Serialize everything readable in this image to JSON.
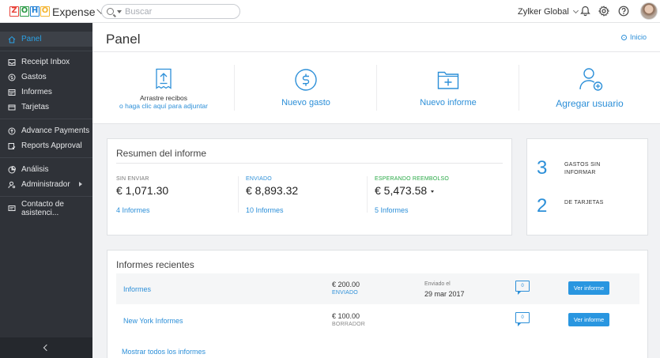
{
  "app": {
    "logo_letters": [
      "Z",
      "O",
      "H",
      "O"
    ],
    "logo_colors": [
      "#e8433a",
      "#2b9a46",
      "#1f7fd4",
      "#f3b431"
    ],
    "product_name": "Expense"
  },
  "topbar": {
    "search_placeholder": "Buscar",
    "org_name": "Zylker Global",
    "icons": [
      "bell-icon",
      "gear-icon",
      "help-icon"
    ]
  },
  "sidebar": {
    "items": [
      {
        "label": "Panel",
        "icon": "home-icon",
        "active": true
      },
      {
        "label": "Receipt Inbox",
        "icon": "inbox-icon"
      },
      {
        "label": "Gastos",
        "icon": "coin-icon"
      },
      {
        "label": "Informes",
        "icon": "report-icon"
      },
      {
        "label": "Tarjetas",
        "icon": "card-icon"
      },
      {
        "label": "Advance Payments",
        "icon": "advance-icon"
      },
      {
        "label": "Reports Approval",
        "icon": "approval-icon"
      },
      {
        "label": "Análisis",
        "icon": "analytics-icon"
      },
      {
        "label": "Administrador",
        "icon": "admin-icon",
        "has_submenu": true
      },
      {
        "label": "Contacto de asistenci...",
        "icon": "chat-icon"
      }
    ]
  },
  "header": {
    "title": "Panel",
    "home_link": "Inicio"
  },
  "quick_actions": {
    "upload_title": "Arrastre recibos",
    "upload_subtitle": "o haga clic aquí para adjuntar",
    "new_expense": "Nuevo gasto",
    "new_report": "Nuevo informe",
    "add_user": "Agregar usuario"
  },
  "summary": {
    "title": "Resumen del informe",
    "columns": [
      {
        "status": "SIN ENVIAR",
        "amount": "€ 1,071.30",
        "link": "4 Informes",
        "color": "#777777"
      },
      {
        "status": "ENVIADO",
        "amount": "€ 8,893.32",
        "link": "10 Informes",
        "color": "#2c8fd8"
      },
      {
        "status": "ESPERANDO REEMBOLSO",
        "amount": "€ 5,473.58",
        "link": "5 Informes",
        "color": "#27a844"
      }
    ]
  },
  "stats": [
    {
      "number": "3",
      "label": "GASTOS SIN INFORMAR"
    },
    {
      "number": "2",
      "label": "DE TARJETAS"
    }
  ],
  "recent": {
    "title": "Informes recientes",
    "rows": [
      {
        "name": "Informes",
        "amount": "€ 200.00",
        "status": "ENVIADO",
        "status_color": "#2c8fd8",
        "date_label": "Enviado el",
        "date": "29 mar 2017",
        "comments": "0",
        "button": "Ver informe"
      },
      {
        "name": "New York Informes",
        "amount": "€ 100.00",
        "status": "BORRADOR",
        "status_color": "#888888",
        "date_label": "",
        "date": "",
        "comments": "0",
        "button": "Ver informe"
      }
    ],
    "show_all": "Mostrar todos los informes"
  }
}
